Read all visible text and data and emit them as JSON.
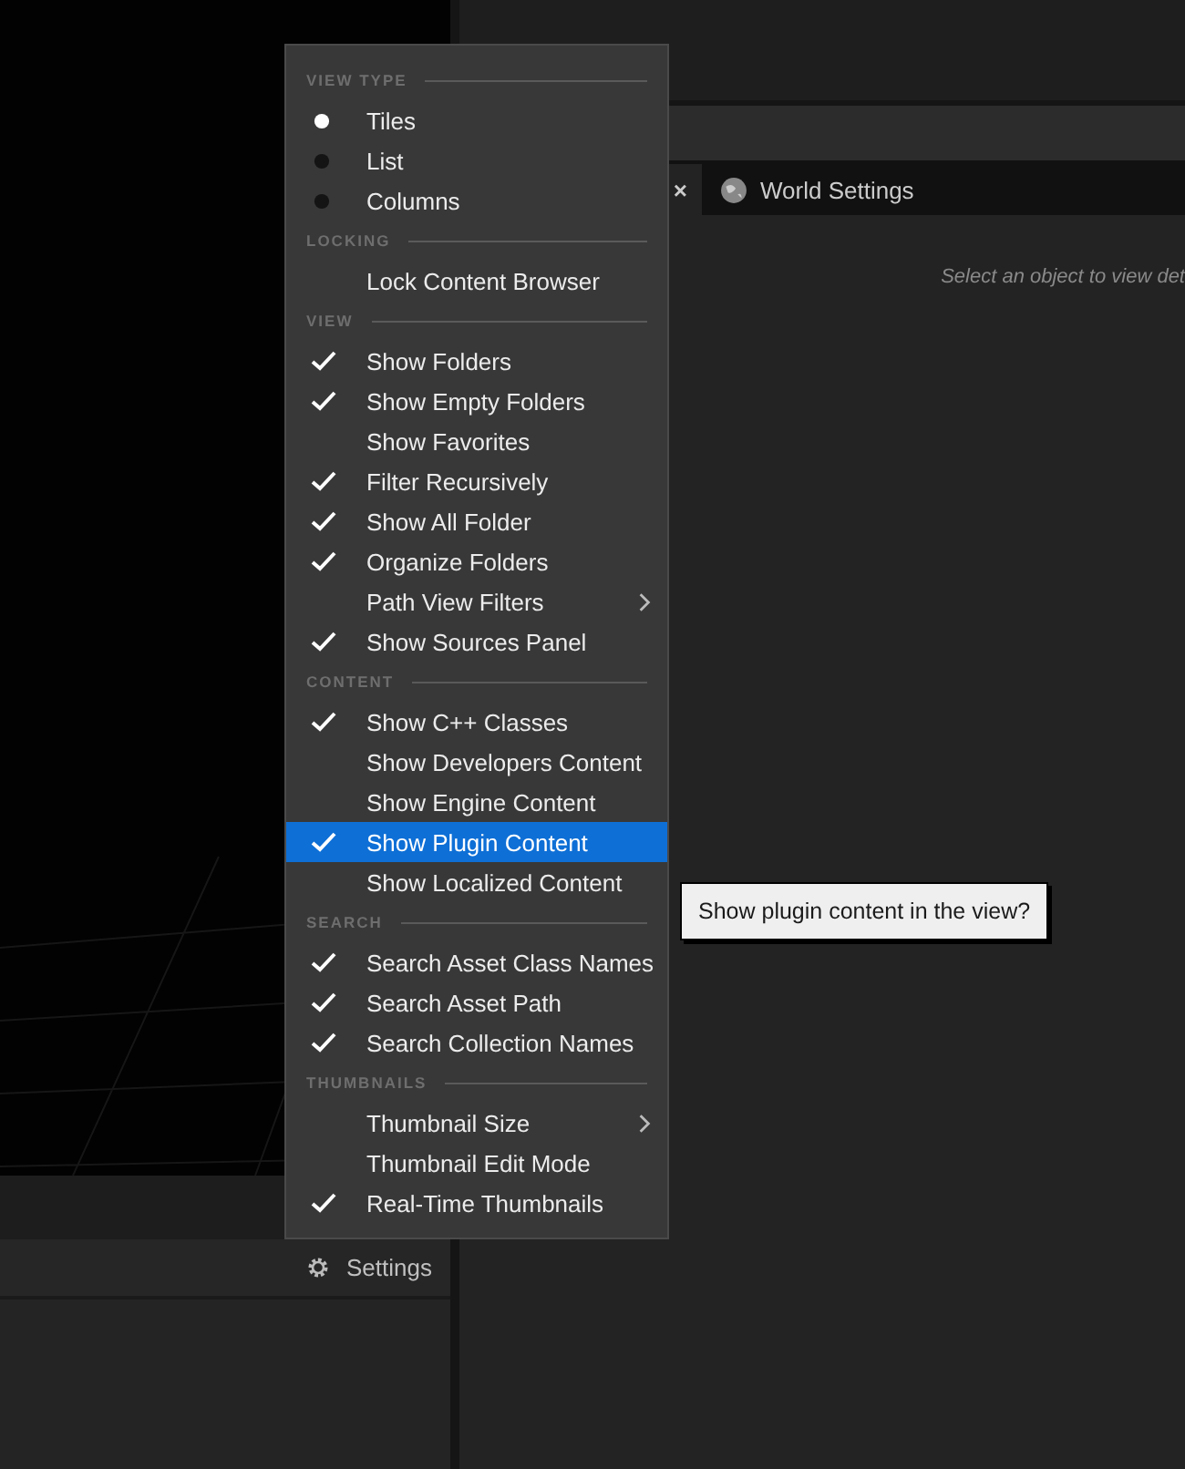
{
  "menu": {
    "sections": [
      {
        "title": "VIEW TYPE",
        "items": [
          {
            "label": "Tiles",
            "kind": "radio",
            "selected": true,
            "hovered": false
          },
          {
            "label": "List",
            "kind": "radio",
            "selected": false,
            "hovered": false
          },
          {
            "label": "Columns",
            "kind": "radio",
            "selected": false,
            "hovered": false
          }
        ]
      },
      {
        "title": "LOCKING",
        "items": [
          {
            "label": "Lock Content Browser",
            "kind": "check",
            "checked": false,
            "hovered": false
          }
        ]
      },
      {
        "title": "VIEW",
        "items": [
          {
            "label": "Show Folders",
            "kind": "check",
            "checked": true,
            "hovered": false
          },
          {
            "label": "Show Empty Folders",
            "kind": "check",
            "checked": true,
            "hovered": false
          },
          {
            "label": "Show Favorites",
            "kind": "check",
            "checked": false,
            "hovered": false
          },
          {
            "label": "Filter Recursively",
            "kind": "check",
            "checked": true,
            "hovered": false
          },
          {
            "label": "Show All Folder",
            "kind": "check",
            "checked": true,
            "hovered": false
          },
          {
            "label": "Organize Folders",
            "kind": "check",
            "checked": true,
            "hovered": false
          },
          {
            "label": "Path View Filters",
            "kind": "submenu",
            "hovered": false
          },
          {
            "label": "Show Sources Panel",
            "kind": "check",
            "checked": true,
            "hovered": false
          }
        ]
      },
      {
        "title": "CONTENT",
        "items": [
          {
            "label": "Show C++ Classes",
            "kind": "check",
            "checked": true,
            "hovered": false
          },
          {
            "label": "Show Developers Content",
            "kind": "check",
            "checked": false,
            "hovered": false
          },
          {
            "label": "Show Engine Content",
            "kind": "check",
            "checked": false,
            "hovered": false
          },
          {
            "label": "Show Plugin Content",
            "kind": "check",
            "checked": true,
            "hovered": true
          },
          {
            "label": "Show Localized Content",
            "kind": "check",
            "checked": false,
            "hovered": false
          }
        ]
      },
      {
        "title": "SEARCH",
        "items": [
          {
            "label": "Search Asset Class Names",
            "kind": "check",
            "checked": true,
            "hovered": false
          },
          {
            "label": "Search Asset Path",
            "kind": "check",
            "checked": true,
            "hovered": false
          },
          {
            "label": "Search Collection Names",
            "kind": "check",
            "checked": true,
            "hovered": false
          }
        ]
      },
      {
        "title": "THUMBNAILS",
        "items": [
          {
            "label": "Thumbnail Size",
            "kind": "submenu",
            "hovered": false
          },
          {
            "label": "Thumbnail Edit Mode",
            "kind": "check",
            "checked": false,
            "hovered": false
          },
          {
            "label": "Real-Time Thumbnails",
            "kind": "check",
            "checked": true,
            "hovered": false
          }
        ]
      }
    ]
  },
  "tooltip": "Show plugin content in the view?",
  "settings_button": "Settings",
  "tabs": [
    {
      "close": "×",
      "selected": true
    },
    {
      "label": "World Settings",
      "selected": false
    }
  ],
  "details_hint": "Select an object to view det"
}
